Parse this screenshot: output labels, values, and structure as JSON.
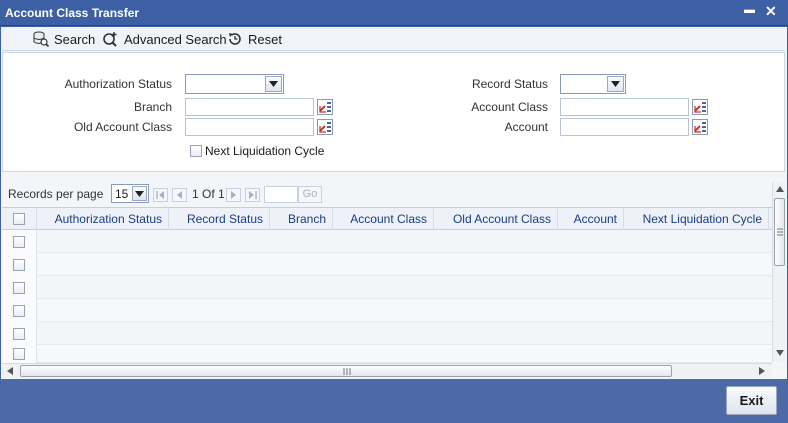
{
  "window": {
    "title": "Account Class Transfer",
    "minimize_glyph": "▬",
    "close_glyph": "✕"
  },
  "toolbar": {
    "search_label": "Search",
    "advanced_search_label": "Advanced Search",
    "reset_label": "Reset"
  },
  "criteria": {
    "authorization_status_label": "Authorization Status",
    "branch_label": "Branch",
    "old_account_class_label": "Old Account Class",
    "record_status_label": "Record Status",
    "account_class_label": "Account Class",
    "account_label": "Account",
    "next_liquidation_cycle_label": "Next Liquidation Cycle",
    "authorization_status_value": "",
    "record_status_value": "",
    "branch_value": "",
    "old_account_class_value": "",
    "account_class_value": "",
    "account_value": ""
  },
  "pager": {
    "records_per_page_label": "Records per page",
    "records_per_page_value": "15",
    "page_info": "1 Of 1",
    "go_label": "Go",
    "page_input_value": ""
  },
  "grid": {
    "columns": [
      "Authorization Status",
      "Record Status",
      "Branch",
      "Account Class",
      "Old Account Class",
      "Account",
      "Next Liquidation Cycle"
    ],
    "row_count": 6
  },
  "footer": {
    "exit_label": "Exit"
  },
  "colors": {
    "title_bar": "#3d5fa3",
    "footer": "#4c6aa5",
    "header_text": "#1a3d85"
  }
}
